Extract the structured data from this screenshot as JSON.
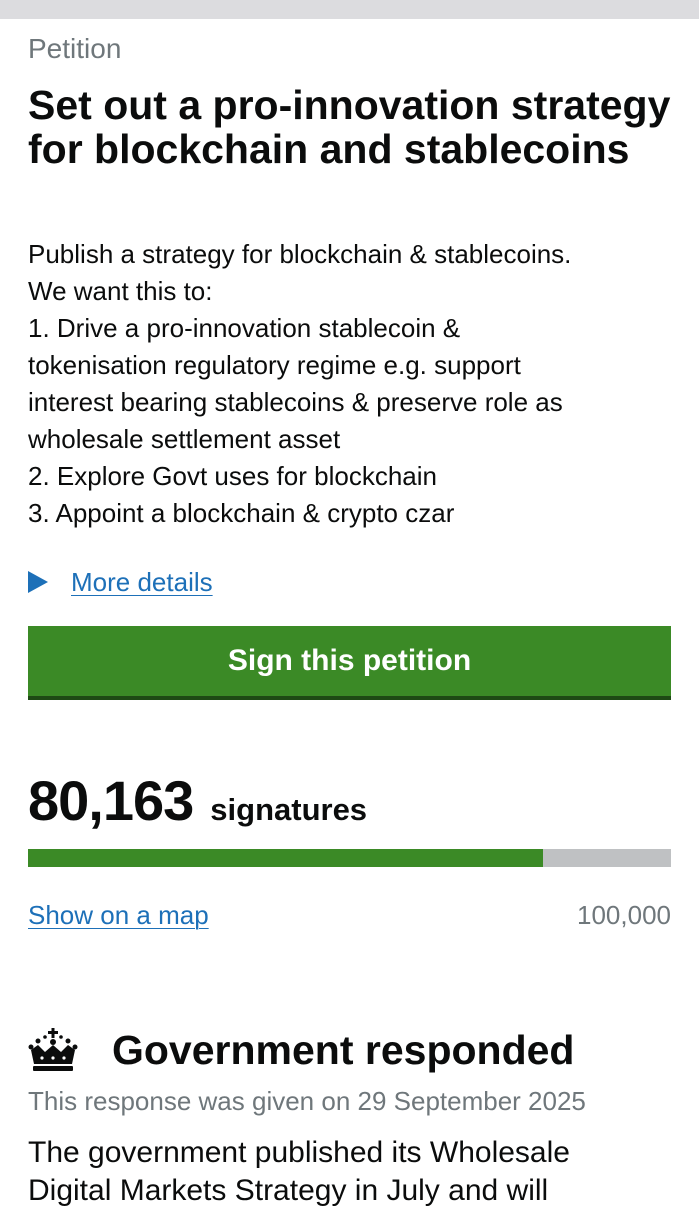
{
  "petition": {
    "eyebrow": "Petition",
    "title": "Set out a pro-innovation strategy for blockchain and stablecoins",
    "summary_lines": [
      "Publish a strategy for blockchain & stablecoins.",
      "We want this to:",
      "1. Drive a pro-innovation stablecoin &",
      "tokenisation regulatory regime e.g. support",
      "interest bearing stablecoins & preserve role as",
      "wholesale settlement asset",
      "2. Explore Govt uses for blockchain",
      "3. Appoint a blockchain & crypto czar"
    ],
    "more_details_label": "More details",
    "sign_button_label": "Sign this petition"
  },
  "signatures": {
    "count": "80,163",
    "label": "signatures",
    "progress_fraction": 0.80163,
    "map_link_label": "Show on a map",
    "target": "100,000"
  },
  "response": {
    "heading": "Government responded",
    "date_text": "This response was given on 29 September 2025",
    "body_lines": [
      "The government published its Wholesale",
      "Digital Markets Strategy in July and will"
    ]
  },
  "icons": {
    "details": "triangle-right-icon",
    "government": "crown-icon"
  },
  "colors": {
    "green": "#3b8a26",
    "link_blue": "#1d70b8",
    "secondary_text": "#6f777b",
    "progress_track": "#bfc1c3"
  }
}
